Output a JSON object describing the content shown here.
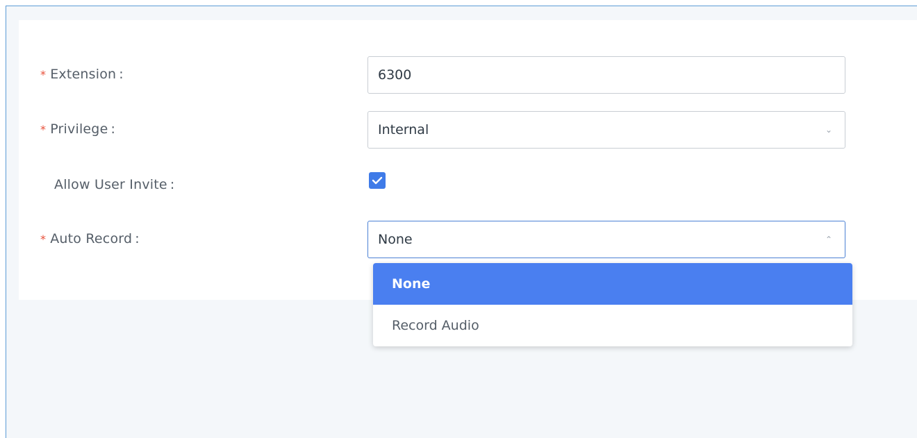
{
  "form": {
    "extension": {
      "required_mark": "*",
      "label": "Extension",
      "colon": ":",
      "value": "6300"
    },
    "privilege": {
      "required_mark": "*",
      "label": "Privilege",
      "colon": ":",
      "value": "Internal",
      "chevron": "⌄"
    },
    "allow_user_invite": {
      "label": "Allow User Invite",
      "colon": ":",
      "checked": true
    },
    "auto_record": {
      "required_mark": "*",
      "label": "Auto Record",
      "colon": ":",
      "value": "None",
      "chevron": "⌃"
    }
  },
  "dropdown": {
    "options": [
      {
        "label": "None",
        "selected": true
      },
      {
        "label": "Record Audio",
        "selected": false
      }
    ]
  },
  "colors": {
    "accent": "#3f7be8",
    "selected_option_bg": "#4a7ff0",
    "required": "#e8503a",
    "frame_border": "#5b9bd5",
    "page_bg": "#f4f7fa"
  }
}
